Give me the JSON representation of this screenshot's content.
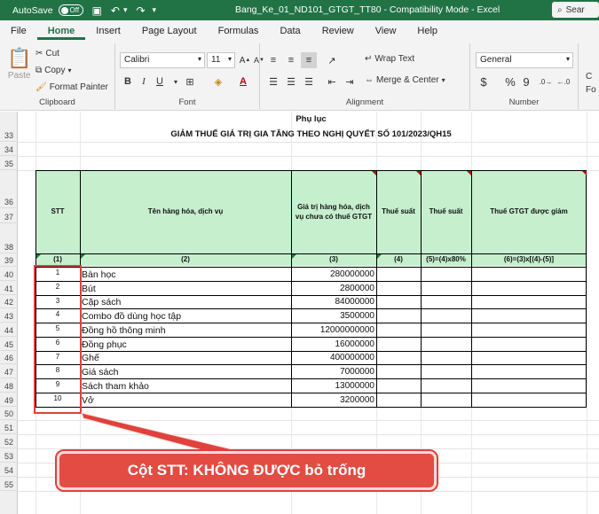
{
  "titlebar": {
    "autosave_label": "AutoSave",
    "toggle_state": "Off",
    "title": "Bang_Ke_01_ND101_GTGT_TT80  -  Compatibility Mode  -  Excel",
    "search": "Sear"
  },
  "tabs": [
    "File",
    "Home",
    "Insert",
    "Page Layout",
    "Formulas",
    "Data",
    "Review",
    "View",
    "Help"
  ],
  "ribbon": {
    "clipboard": {
      "paste": "Paste",
      "cut": "Cut",
      "copy": "Copy",
      "format_painter": "Format Painter",
      "label": "Clipboard"
    },
    "font": {
      "font_name": "Calibri",
      "font_size": "11",
      "label": "Font"
    },
    "alignment": {
      "wrap_text": "Wrap Text",
      "merge_center": "Merge & Center",
      "label": "Alignment"
    },
    "number": {
      "format": "General",
      "currency": "$",
      "percent": "%",
      "comma": "9",
      "label": "Number"
    },
    "partial_group": [
      "C",
      "Fo"
    ]
  },
  "rows": [
    "33",
    "34",
    "35",
    "36",
    "37",
    "38",
    "39",
    "40",
    "41",
    "42",
    "43",
    "44",
    "45",
    "46",
    "47",
    "48",
    "49",
    "50",
    "51",
    "52",
    "53",
    "54",
    "55"
  ],
  "sheet": {
    "heading1": "Phụ lục",
    "heading2": "GIẢM THUẾ GIÁ TRỊ GIA TĂNG THEO NGHỊ QUYẾT SỐ 101/2023/QH15"
  },
  "table": {
    "headers": [
      "STT",
      "Tên hàng hóa, dịch vụ",
      "Giá trị hàng hóa, dịch vụ chưa có thuế GTGT",
      "Thuế suất",
      "Thuế suất",
      "Thuế GTGT được giảm"
    ],
    "codes": [
      "(1)",
      "(2)",
      "(3)",
      "(4)",
      "(5)=(4)x80%",
      "(6)=(3)x[(4)-(5)]"
    ],
    "rows": [
      {
        "stt": "1",
        "name": "Bàn học",
        "value": "280000000"
      },
      {
        "stt": "2",
        "name": "Bút",
        "value": "2800000"
      },
      {
        "stt": "3",
        "name": "Cặp sách",
        "value": "84000000"
      },
      {
        "stt": "4",
        "name": "Combo đồ dùng học tập",
        "value": "3500000"
      },
      {
        "stt": "5",
        "name": "Đồng hồ thông minh",
        "value": "12000000000"
      },
      {
        "stt": "6",
        "name": "Đồng phục",
        "value": "16000000"
      },
      {
        "stt": "7",
        "name": "Ghế",
        "value": "400000000"
      },
      {
        "stt": "8",
        "name": "Giá sách",
        "value": "7000000"
      },
      {
        "stt": "9",
        "name": "Sách tham khảo",
        "value": "13000000"
      },
      {
        "stt": "10",
        "name": "Vở",
        "value": "3200000"
      }
    ]
  },
  "callout": "Cột STT: KHÔNG ĐƯỢC bỏ trống",
  "colors": {
    "excel_green": "#217346",
    "header_fill": "#c6efce",
    "annotation_red": "#e0413b"
  }
}
